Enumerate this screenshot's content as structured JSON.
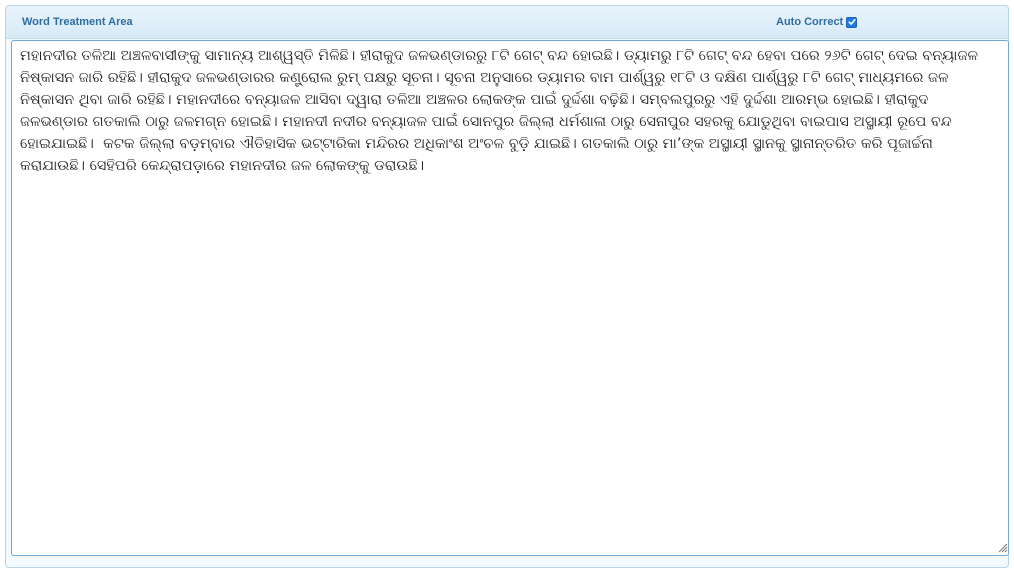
{
  "panel": {
    "title": "Word Treatment Area",
    "auto_correct": {
      "label": "Auto Correct",
      "checked": true
    }
  },
  "editor": {
    "text": "ମହାନଦୀର ତଳିଆ ଅଞ୍ଚଳବାସୀଙ୍କୁ ସାମାନ୍ୟ ଆଶ୍ୱସ୍ତି ମିଳିଛି। ହୀରାକୁଦ ଜଳଭଣ୍ଡାରରୁ ୮ଟି ଗେଟ୍ ବନ୍ଦ ହୋଇଛି। ଡ୍ୟାମରୁ ୮ଟି ଗେଟ୍ ବନ୍ଦ ହେବା ପରେ ୨୬ଟି ଗେଟ୍ ଦେଇ ବନ୍ୟାଜଳ ନିଷ୍କାସନ ଜାରି ରହିଛି। ହୀରାକୁଦ ଜଳଭଣ୍ଡାରର କଣ୍ଟ୍ରୋଲ ରୁମ୍ ପକ୍ଷରୁ ସୂଚନା। ସୂଚନା ଅନୁସାରେ ଡ୍ୟାମର ବାମ ପାର୍ଶ୍ୱରୁ ୧୮ଟି ଓ ଦକ୍ଷିଣ ପାର୍ଶ୍ୱରୁ ୮ଟି ଗେଟ୍ ମାଧ୍ୟମରେ ଜଳ ନିଷ୍କାସନ ଥିବା ଜାରି ରହିଛି। ମହାନଦୀରେ ବନ୍ୟାଜଳ ଆସିବା ଦ୍ୱାରା ତଳିଆ ଅଞ୍ଚଳର ଲୋକଙ୍କ ପାଇଁ ଦୁର୍ଦ୍ଦଶା ବଢ଼ିଛି। ସମ୍ବଲପୁରରୁ ଏହି ଦୁର୍ଦ୍ଦଶା ଆରମ୍ଭ ହୋଇଛି। ହୀରାକୁଦ ଜଳଭଣ୍ଡାର ଗତକାଲି ଠାରୁ ଜଳମଗ୍ନ ହୋଇଛି। ମହାନଦୀ ନଦୀର ବନ୍ୟାଜଳ ପାଇଁ ସୋନପୁର ଜିଲ୍ଲା ଧର୍ମଶାଳା ଠାରୁ ସେନାପୁର ସହରକୁ ଯୋଡୁଥିବା ବାଇପାସ ଅସ୍ଥାୟୀ ରୂପେ ବନ୍ଦ ହୋଇଯାଇଛି।  କଟକ ଜିଲ୍ଲା ବଡ଼ମ୍ବାର ଐତିହାସିକ ଭଟ୍ଟାରିକା ମନ୍ଦିରର ଅଧିକାଂଶ ଅଂଚଳ ବୁଡ଼ି ଯାଇଛି। ଗତକାଲି ଠାରୁ ମା’ଙ୍କ ଅସ୍ଥାୟୀ ସ୍ଥାନକୁ ସ୍ଥାନାନ୍ତରିତ କରି ପୂଜାର୍ଚ୍ଚନା କରାଯାଉଛି। ସେହିପରି କେନ୍ଦ୍ରାପଡ଼ାରେ ମହାନଦୀର ଜଳ ଲୋକଙ୍କୁ ଡରାଉଛି।"
  },
  "colors": {
    "header_text": "#2e6e9e",
    "editor_border": "#6ea8db",
    "checkbox": "#1f7ae0"
  },
  "icons": {
    "checkbox": "checkmark-icon",
    "resize": "resize-grip-icon"
  }
}
